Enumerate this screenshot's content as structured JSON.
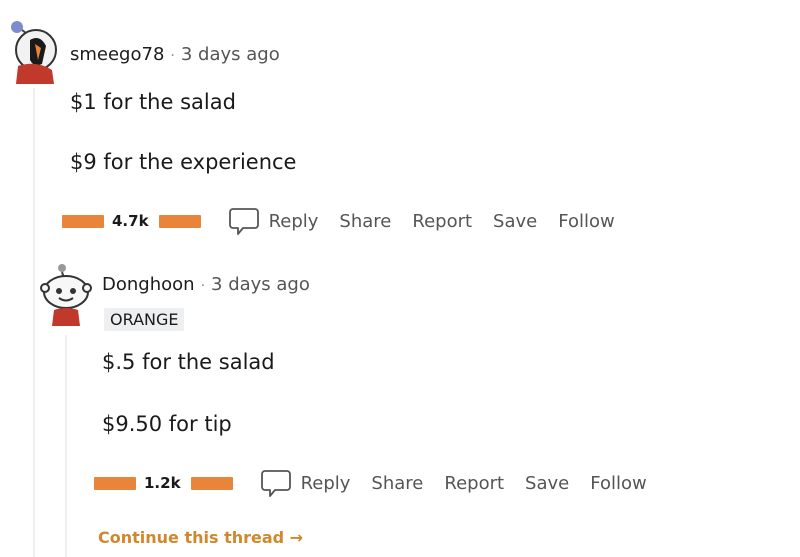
{
  "comments": [
    {
      "username": "smeego78",
      "separator": "·",
      "time": "3 days ago",
      "paragraphs": [
        "$1 for the salad",
        "$9 for the experience"
      ],
      "votes": "4.7k",
      "actions": [
        "Reply",
        "Share",
        "Report",
        "Save",
        "Follow"
      ],
      "avatar_icon": "snoo-avatar-icon"
    },
    {
      "username": "Donghoon",
      "separator": "·",
      "time": "3 days ago",
      "flair": "ORANGE",
      "paragraphs": [
        "$.5 for the salad",
        "$9.50 for tip"
      ],
      "votes": "1.2k",
      "actions": [
        "Reply",
        "Share",
        "Report",
        "Save",
        "Follow"
      ],
      "avatar_icon": "snoo-avatar-icon"
    }
  ],
  "continue_thread": "Continue this thread →",
  "colors": {
    "vote_bar": "#e8853b",
    "continue_link": "#d1882c",
    "thread_line": "#edeff1"
  }
}
